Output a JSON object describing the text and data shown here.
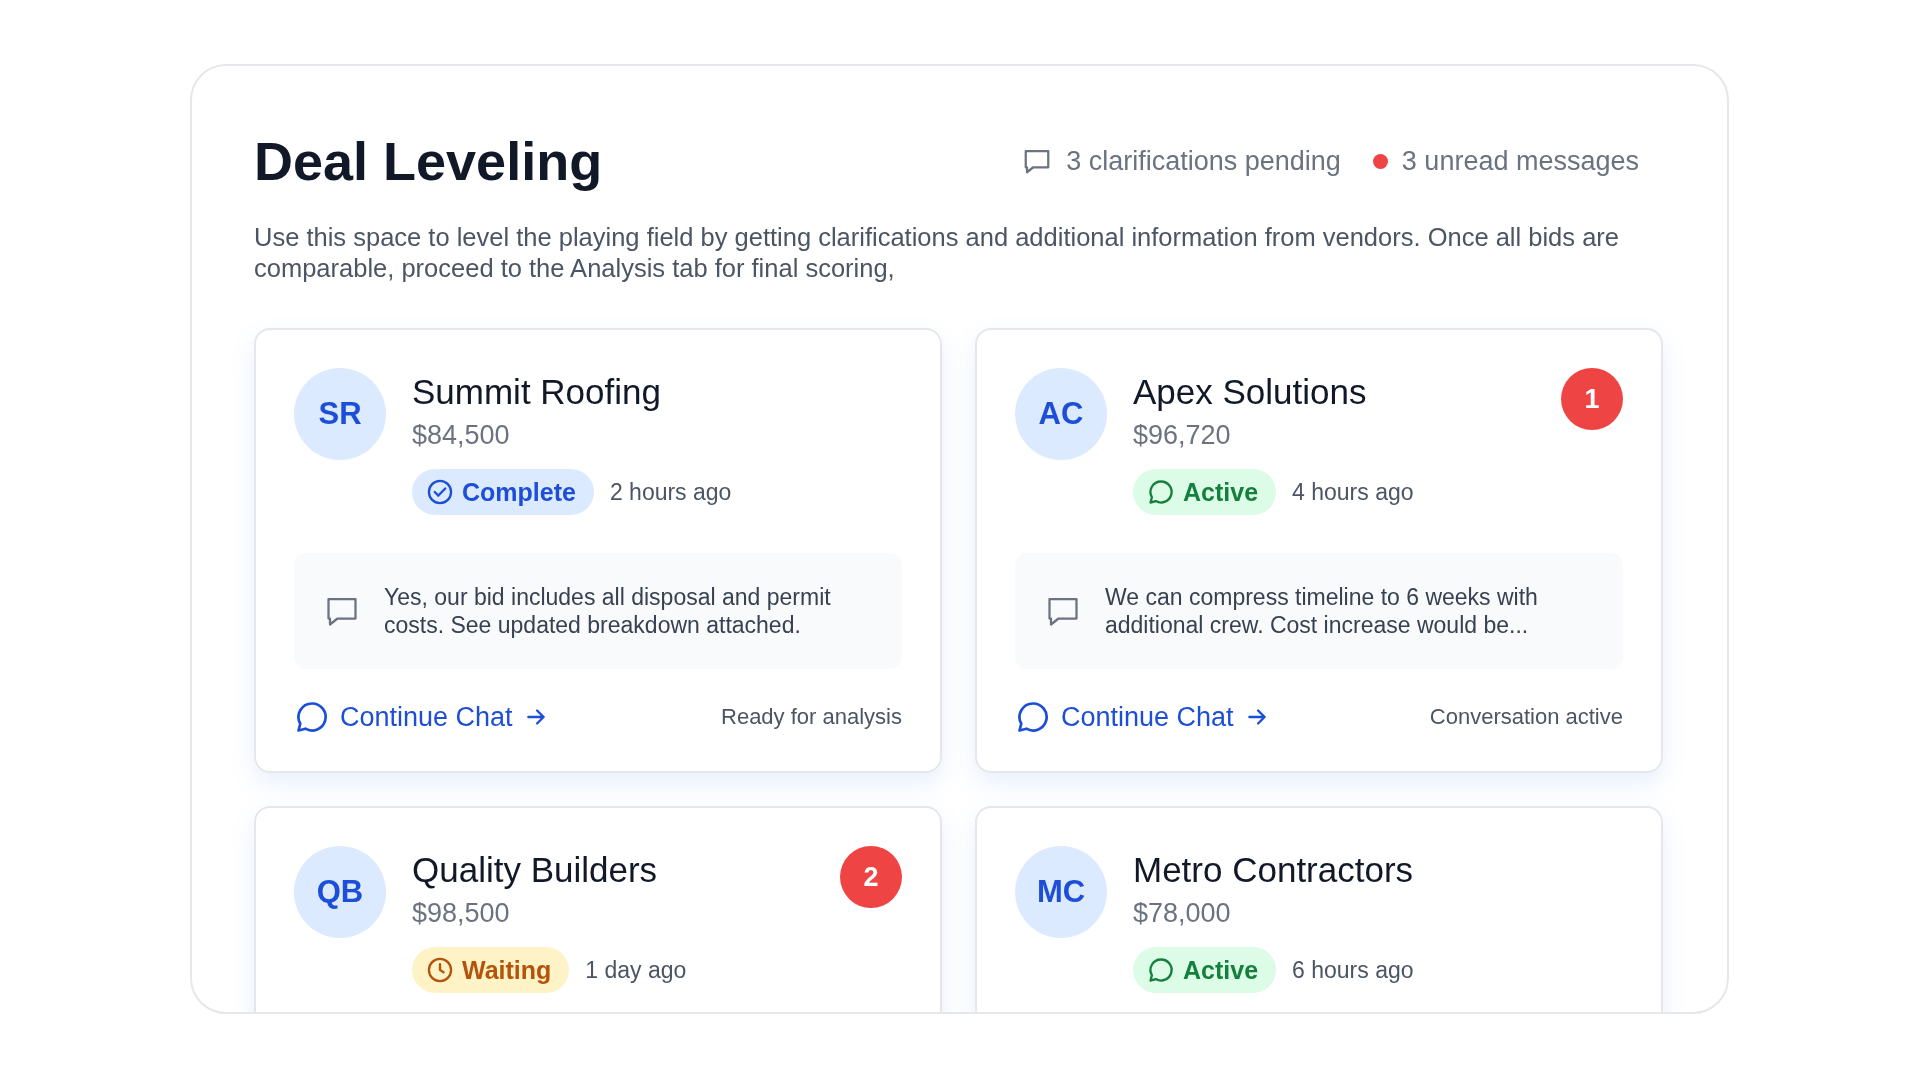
{
  "header": {
    "title": "Deal Leveling",
    "clarifications": "3 clarifications pending",
    "unread": "3 unread messages",
    "description": "Use this space to level the playing field by getting clarifications and additional information from vendors. Once all bids are comparable, proceed to the Analysis tab for final scoring,"
  },
  "vendors": [
    {
      "initials": "SR",
      "name": "Summit Roofing",
      "price": "$84,500",
      "status": {
        "kind": "complete",
        "label": "Complete"
      },
      "time": "2 hours ago",
      "message": "Yes, our bid includes all disposal and permit costs. See updated breakdown attached.",
      "action": "Continue Chat",
      "note": "Ready for analysis"
    },
    {
      "initials": "AC",
      "name": "Apex Solutions",
      "price": "$96,720",
      "badge": "1",
      "status": {
        "kind": "active",
        "label": "Active"
      },
      "time": "4 hours ago",
      "message": "We can compress timeline to 6 weeks with additional crew. Cost increase would be...",
      "action": "Continue Chat",
      "note": "Conversation active"
    },
    {
      "initials": "QB",
      "name": "Quality Builders",
      "price": "$98,500",
      "badge": "2",
      "status": {
        "kind": "waiting",
        "label": "Waiting"
      },
      "time": "1 day ago"
    },
    {
      "initials": "MC",
      "name": "Metro Contractors",
      "price": "$78,000",
      "status": {
        "kind": "active",
        "label": "Active"
      },
      "time": "6 hours ago"
    }
  ]
}
